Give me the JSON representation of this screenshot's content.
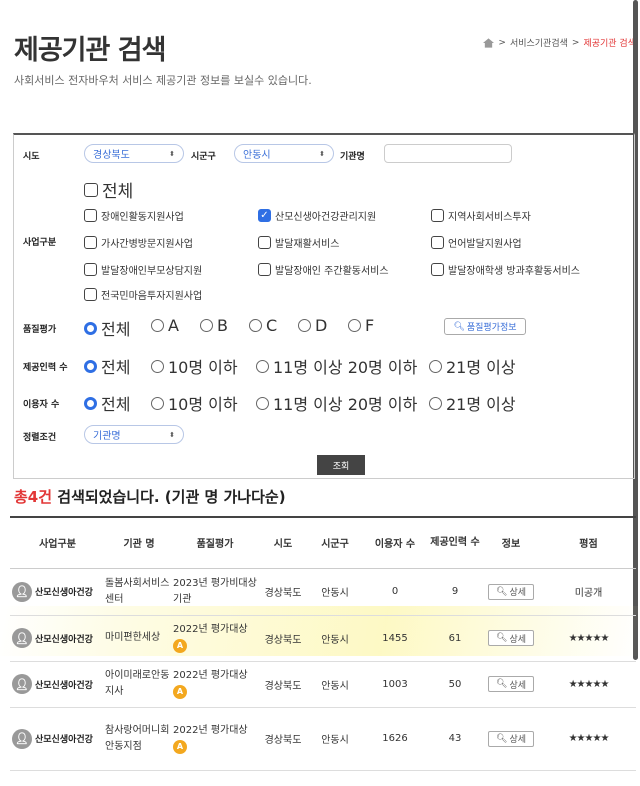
{
  "header": {
    "title": "제공기관 검색",
    "description": "사회서비스 전자바우처 서비스 제공기관 정보를 보실수 있습니다.",
    "breadcrumb": [
      "서비스기관검색",
      "제공기관 검색"
    ]
  },
  "filters": {
    "sido_label": "시도",
    "sido_value": "경상북도",
    "sigungu_label": "시군구",
    "sigungu_value": "안동시",
    "org_name_label": "기관명",
    "org_name_value": "",
    "business_label": "사업구분",
    "business_all": "전체",
    "business_items": [
      {
        "label": "장애인활동지원사업",
        "checked": false
      },
      {
        "label": "산모신생아건강관리지원",
        "checked": true
      },
      {
        "label": "지역사회서비스투자",
        "checked": false
      },
      {
        "label": "가사간병방문지원사업",
        "checked": false
      },
      {
        "label": "발달재활서비스",
        "checked": false
      },
      {
        "label": "언어발달지원사업",
        "checked": false
      },
      {
        "label": "발달장애인부모상담지원",
        "checked": false
      },
      {
        "label": "발달장애인 주간활동서비스",
        "checked": false
      },
      {
        "label": "발달장애학생 방과후활동서비스",
        "checked": false
      },
      {
        "label": "전국민마음투자지원사업",
        "checked": false
      }
    ],
    "quality_label": "품질평가",
    "quality_options": [
      "전체",
      "A",
      "B",
      "C",
      "D",
      "F"
    ],
    "quality_selected": "전체",
    "quality_button": "품질평가정보",
    "staff_label": "제공인력 수",
    "staff_options": [
      "전체",
      "10명 이하",
      "11명 이상 20명 이하",
      "21명 이상"
    ],
    "users_label": "이용자 수",
    "users_options": [
      "전체",
      "10명 이하",
      "11명 이상 20명 이하",
      "21명 이상"
    ],
    "sort_label": "정렬조건",
    "sort_value": "기관명",
    "search_button": "조회"
  },
  "results": {
    "count_text": "총4건",
    "summary_text": " 검색되었습니다. (기관 명 가나다순)",
    "columns": [
      "사업구분",
      "기관 명",
      "품질평가",
      "시도",
      "시군구",
      "이용자 수",
      "제공인력 수",
      "정보",
      "평점"
    ],
    "rows": [
      {
        "category": "산모신생아건강",
        "name": "돌봄사회서비스센터",
        "quality": "2023년 평가비대상기관",
        "grade": "",
        "sido": "경상북도",
        "sigungu": "안동시",
        "users": "0",
        "staff": "9",
        "info": "상세",
        "rating": "미공개"
      },
      {
        "category": "산모신생아건강",
        "name": "마미편한세상",
        "quality": "2022년 평가대상",
        "grade": "A",
        "sido": "경상북도",
        "sigungu": "안동시",
        "users": "1455",
        "staff": "61",
        "info": "상세",
        "rating": "★★★★★"
      },
      {
        "category": "산모신생아건강",
        "name": "아이미래로안동지사",
        "quality": "2022년 평가대상",
        "grade": "A",
        "sido": "경상북도",
        "sigungu": "안동시",
        "users": "1003",
        "staff": "50",
        "info": "상세",
        "rating": "★★★★★"
      },
      {
        "category": "산모신생아건강",
        "name": "참사랑어머니회안동지점",
        "quality": "2022년 평가대상",
        "grade": "A",
        "sido": "경상북도",
        "sigungu": "안동시",
        "users": "1626",
        "staff": "43",
        "info": "상세",
        "rating": "★★★★★"
      }
    ]
  }
}
